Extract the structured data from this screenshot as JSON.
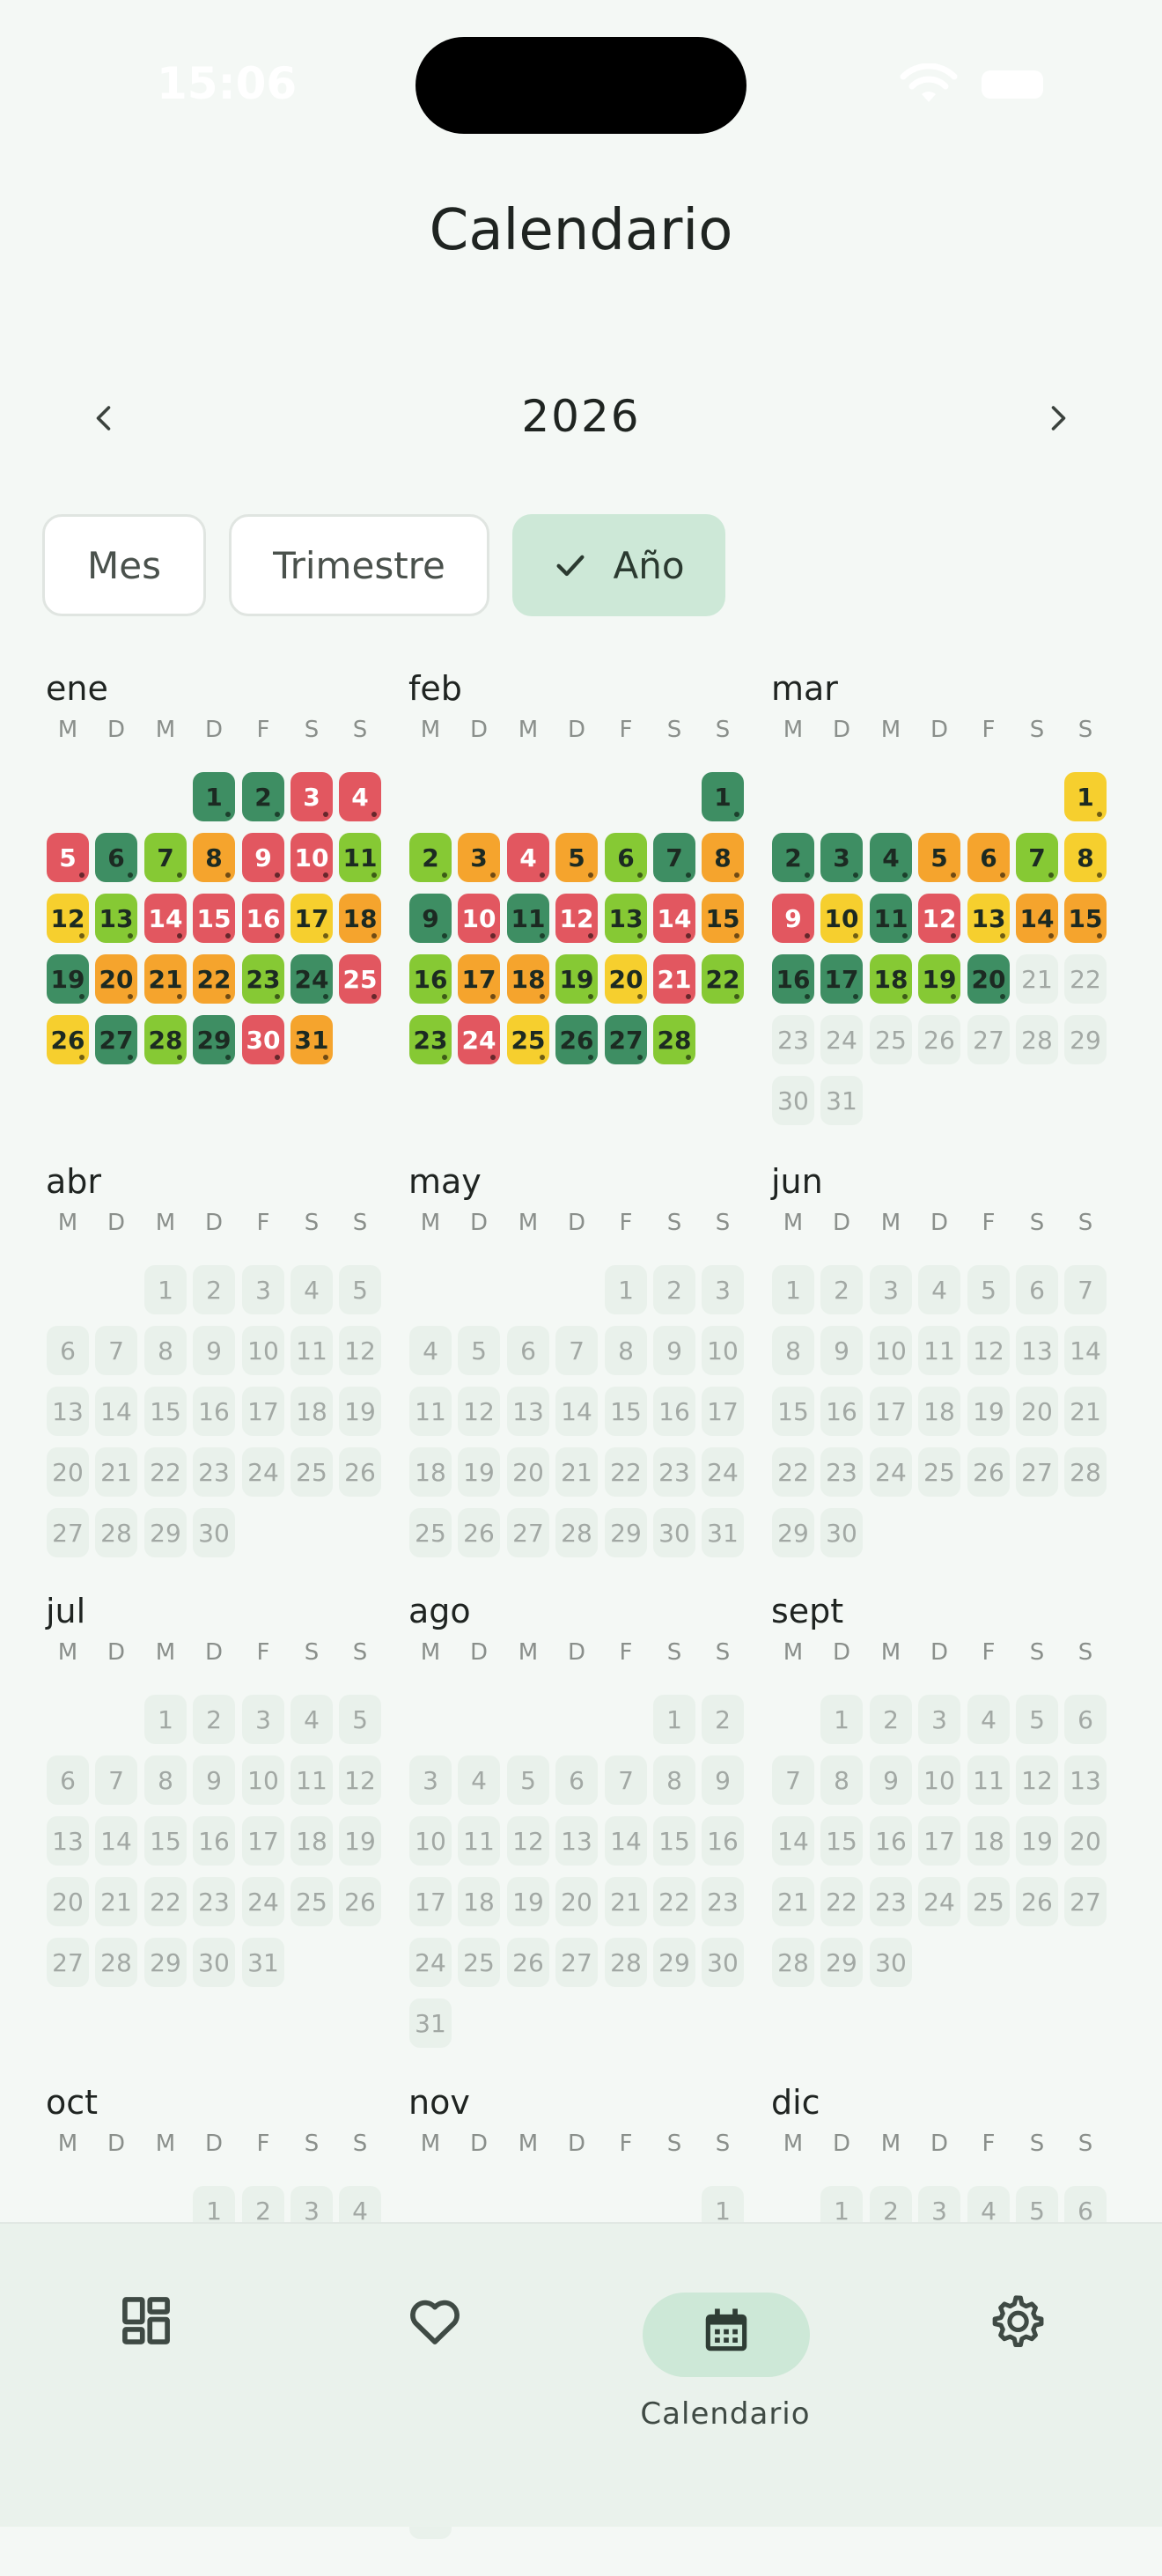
{
  "status_bar": {
    "time": "15:06"
  },
  "page": {
    "title": "Calendario"
  },
  "year_nav": {
    "year": "2026",
    "prev_icon": "chevron-left-icon",
    "next_icon": "chevron-right-icon"
  },
  "view_selector": {
    "options": [
      "Mes",
      "Trimestre",
      "Año"
    ],
    "selected": "Año",
    "selected_icon": "check-icon"
  },
  "weekday_headers": [
    "M",
    "D",
    "M",
    "D",
    "F",
    "S",
    "S"
  ],
  "mood_colors": {
    "deepgreen": "#3e8e63",
    "green": "#86c934",
    "yellow": "#f6cf2e",
    "orange": "#f5a42d",
    "red": "#e25760"
  },
  "months": [
    {
      "name": "ene",
      "offset": 3,
      "days": 31,
      "moods": [
        "deepgreen",
        "deepgreen",
        "red",
        "red",
        "red",
        "deepgreen",
        "green",
        "orange",
        "red",
        "red",
        "green",
        "yellow",
        "green",
        "red",
        "red",
        "red",
        "yellow",
        "orange",
        "deepgreen",
        "orange",
        "orange",
        "orange",
        "green",
        "deepgreen",
        "red",
        "yellow",
        "deepgreen",
        "green",
        "deepgreen",
        "red",
        "orange"
      ]
    },
    {
      "name": "feb",
      "offset": 6,
      "days": 28,
      "moods": [
        "deepgreen",
        "green",
        "orange",
        "red",
        "orange",
        "green",
        "deepgreen",
        "orange",
        "deepgreen",
        "red",
        "deepgreen",
        "red",
        "green",
        "red",
        "orange",
        "green",
        "orange",
        "orange",
        "green",
        "yellow",
        "red",
        "green",
        "green",
        "red",
        "yellow",
        "deepgreen",
        "deepgreen",
        "green"
      ]
    },
    {
      "name": "mar",
      "offset": 6,
      "days": 31,
      "moods": [
        "yellow",
        "deepgreen",
        "deepgreen",
        "deepgreen",
        "orange",
        "orange",
        "green",
        "yellow",
        "red",
        "yellow",
        "deepgreen",
        "red",
        "yellow",
        "orange",
        "orange",
        "deepgreen",
        "deepgreen",
        "green",
        "green",
        "deepgreen"
      ]
    },
    {
      "name": "abr",
      "offset": 2,
      "days": 30,
      "moods": []
    },
    {
      "name": "may",
      "offset": 4,
      "days": 31,
      "moods": []
    },
    {
      "name": "jun",
      "offset": 0,
      "days": 30,
      "moods": []
    },
    {
      "name": "jul",
      "offset": 2,
      "days": 31,
      "moods": []
    },
    {
      "name": "ago",
      "offset": 5,
      "days": 31,
      "moods": []
    },
    {
      "name": "sept",
      "offset": 1,
      "days": 30,
      "moods": []
    },
    {
      "name": "oct",
      "offset": 3,
      "days": 31,
      "moods": []
    },
    {
      "name": "nov",
      "offset": 6,
      "days": 30,
      "moods": []
    },
    {
      "name": "dic",
      "offset": 1,
      "days": 31,
      "moods": []
    }
  ],
  "bottom_nav": {
    "items": [
      {
        "icon": "dashboard-icon",
        "label": ""
      },
      {
        "icon": "heart-icon",
        "label": ""
      },
      {
        "icon": "calendar-icon",
        "label": "Calendario"
      },
      {
        "icon": "settings-icon",
        "label": ""
      }
    ],
    "active": "Calendario"
  }
}
